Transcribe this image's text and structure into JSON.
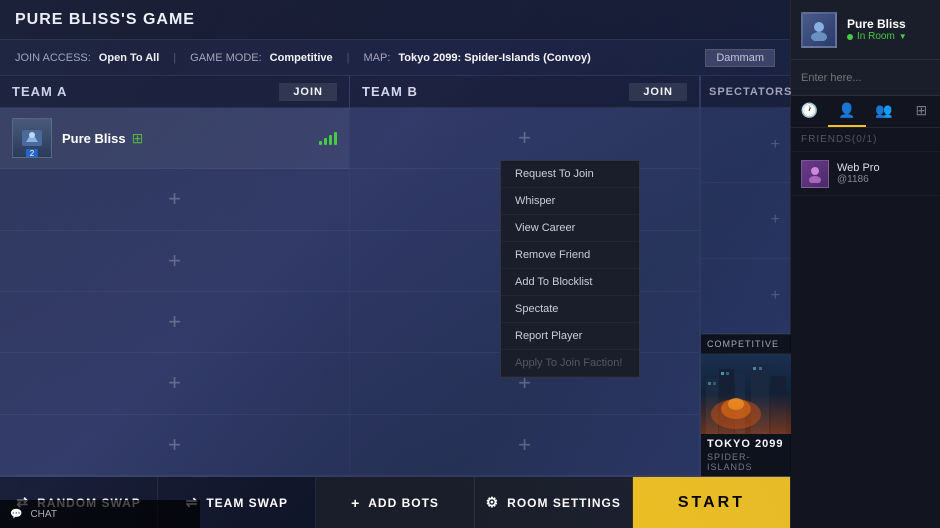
{
  "window": {
    "title": "Pure Bliss'S GAME"
  },
  "info_bar": {
    "join_access_label": "JOIN ACCESS:",
    "join_access_value": "Open To All",
    "game_mode_label": "GAME MODE:",
    "game_mode_value": "Competitive",
    "map_label": "MAP:",
    "map_value": "Tokyo 2099: Spider-Islands (Convoy)",
    "region": "Dammam"
  },
  "team_a": {
    "name": "TEAM A",
    "join_label": "JOIN",
    "players": [
      {
        "name": "Pure Bliss",
        "rank": "2",
        "filled": true
      },
      {
        "name": "",
        "filled": false
      },
      {
        "name": "",
        "filled": false
      },
      {
        "name": "",
        "filled": false
      },
      {
        "name": "",
        "filled": false
      },
      {
        "name": "",
        "filled": false
      }
    ]
  },
  "team_b": {
    "name": "TEAM B",
    "join_label": "JOIN",
    "players": [
      {
        "name": "",
        "filled": false
      },
      {
        "name": "",
        "filled": false
      },
      {
        "name": "",
        "filled": false
      },
      {
        "name": "",
        "filled": false
      },
      {
        "name": "",
        "filled": false
      },
      {
        "name": "",
        "filled": false
      }
    ]
  },
  "spectators": {
    "label": "SPECTATORS"
  },
  "map_card": {
    "mode_label": "COMPETITIVE",
    "name": "TOKYO 2099",
    "sublabel": "SPIDER-ISLANDS"
  },
  "actions": {
    "random_swap": "RANDOM SWAP",
    "team_swap": "TEAM SWAP",
    "add_bots": "ADD BOTS",
    "room_settings": "ROOM SETTINGS",
    "start": "START"
  },
  "sidebar": {
    "profile_name": "Pure Bliss",
    "status": "In Room",
    "search_placeholder": "Enter here...",
    "friends_header": "FRIENDS(0/1)",
    "friends": [
      {
        "name": "Web Pro",
        "sub": "@1186"
      }
    ]
  },
  "context_menu": {
    "items": [
      {
        "label": "Request To Join",
        "disabled": false
      },
      {
        "label": "Whisper",
        "disabled": false
      },
      {
        "label": "View Career",
        "disabled": false
      },
      {
        "label": "Remove Friend",
        "disabled": false
      },
      {
        "label": "Add To Blocklist",
        "disabled": false
      },
      {
        "label": "Spectate",
        "disabled": false
      },
      {
        "label": "Report Player",
        "disabled": false
      },
      {
        "label": "Apply To Join Faction!",
        "disabled": true
      }
    ]
  },
  "chat": {
    "label": "CHAT"
  }
}
